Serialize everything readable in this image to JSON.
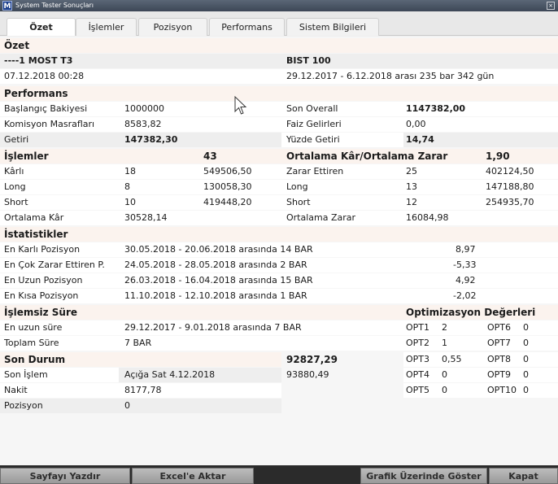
{
  "window": {
    "title": "System Tester Sonuçları",
    "app_icon_letter": "M",
    "close_glyph": "×"
  },
  "tabs": [
    "Özet",
    "İşlemler",
    "Pozisyon",
    "Performans",
    "Sistem Bilgileri"
  ],
  "ozet": {
    "heading": "Özet",
    "system_name": "----1 MOST T3",
    "symbol": "BIST 100",
    "date": "07.12.2018 00:28",
    "range": "29.12.2017 - 6.12.2018 arası 235 bar 342 gün"
  },
  "performans": {
    "heading": "Performans",
    "rows": [
      {
        "l1": "Başlangıç Bakiyesi",
        "v1": "1000000",
        "l2": "Son Overall",
        "v2": "1147382,00"
      },
      {
        "l1": "Komisyon Masrafları",
        "v1": "8583,82",
        "l2": "Faiz Gelirleri",
        "v2": "0,00"
      },
      {
        "l1": "Getiri",
        "v1": "147382,30",
        "l2": "Yüzde Getiri",
        "v2": "14,74"
      }
    ]
  },
  "islemler": {
    "heading": "İşlemler",
    "count": "43",
    "right_heading": "Ortalama Kâr/Ortalama Zarar",
    "right_value": "1,90",
    "rows": [
      {
        "l1": "Kârlı",
        "n1": "18",
        "v1": "549506,50",
        "l2": "Zarar Ettiren",
        "n2": "25",
        "v2": "402124,50"
      },
      {
        "l1": "Long",
        "n1": "8",
        "v1": "130058,30",
        "l2": "Long",
        "n2": "13",
        "v2": "147188,80"
      },
      {
        "l1": "Short",
        "n1": "10",
        "v1": "419448,20",
        "l2": "Short",
        "n2": "12",
        "v2": "254935,70"
      },
      {
        "l1": "Ortalama Kâr",
        "n1": "30528,14",
        "v1": "",
        "l2": "Ortalama Zarar",
        "n2": "16084,98",
        "v2": ""
      }
    ]
  },
  "istatistikler": {
    "heading": "İstatistikler",
    "rows": [
      {
        "label": "En Karlı Pozisyon",
        "text": "30.05.2018 - 20.06.2018 arasında 14 BAR",
        "value": "8,97"
      },
      {
        "label": "En Çok Zarar Ettiren P.",
        "text": "24.05.2018 - 28.05.2018 arasında 2 BAR",
        "value": "-5,33"
      },
      {
        "label": "En Uzun Pozisyon",
        "text": "26.03.2018 - 16.04.2018 arasında 15 BAR",
        "value": "4,92"
      },
      {
        "label": "En Kısa Pozisyon",
        "text": "11.10.2018 - 12.10.2018 arasında 1 BAR",
        "value": "-2,02"
      }
    ]
  },
  "islemsiz": {
    "heading": "İşlemsiz Süre",
    "rows": [
      {
        "label": "En uzun süre",
        "text": "29.12.2017 - 9.01.2018 arasında 7 BAR"
      },
      {
        "label": "Toplam Süre",
        "text": "7 BAR"
      }
    ]
  },
  "optimizasyon": {
    "heading": "Optimizasyon Değerleri",
    "rows": [
      {
        "k1": "OPT1",
        "v1": "2",
        "k2": "OPT6",
        "v2": "0"
      },
      {
        "k1": "OPT2",
        "v1": "1",
        "k2": "OPT7",
        "v2": "0"
      },
      {
        "k1": "OPT3",
        "v1": "0,55",
        "k2": "OPT8",
        "v2": "0"
      },
      {
        "k1": "OPT4",
        "v1": "0",
        "k2": "OPT9",
        "v2": "0"
      },
      {
        "k1": "OPT5",
        "v1": "0",
        "k2": "OPT10",
        "v2": "0"
      }
    ]
  },
  "son_durum": {
    "heading": "Son Durum",
    "heading_value": "92827,29",
    "rows": [
      {
        "label": "Son İşlem",
        "value": "Açığa Sat  4.12.2018",
        "extra": "93880,49"
      },
      {
        "label": "Nakit",
        "value": "8177,78",
        "extra": ""
      },
      {
        "label": "Pozisyon",
        "value": "0",
        "extra": ""
      }
    ]
  },
  "buttons": [
    "Sayfayı Yazdır",
    "Excel'e Aktar",
    "Grafik Üzerinde Göster",
    "Kapat"
  ]
}
